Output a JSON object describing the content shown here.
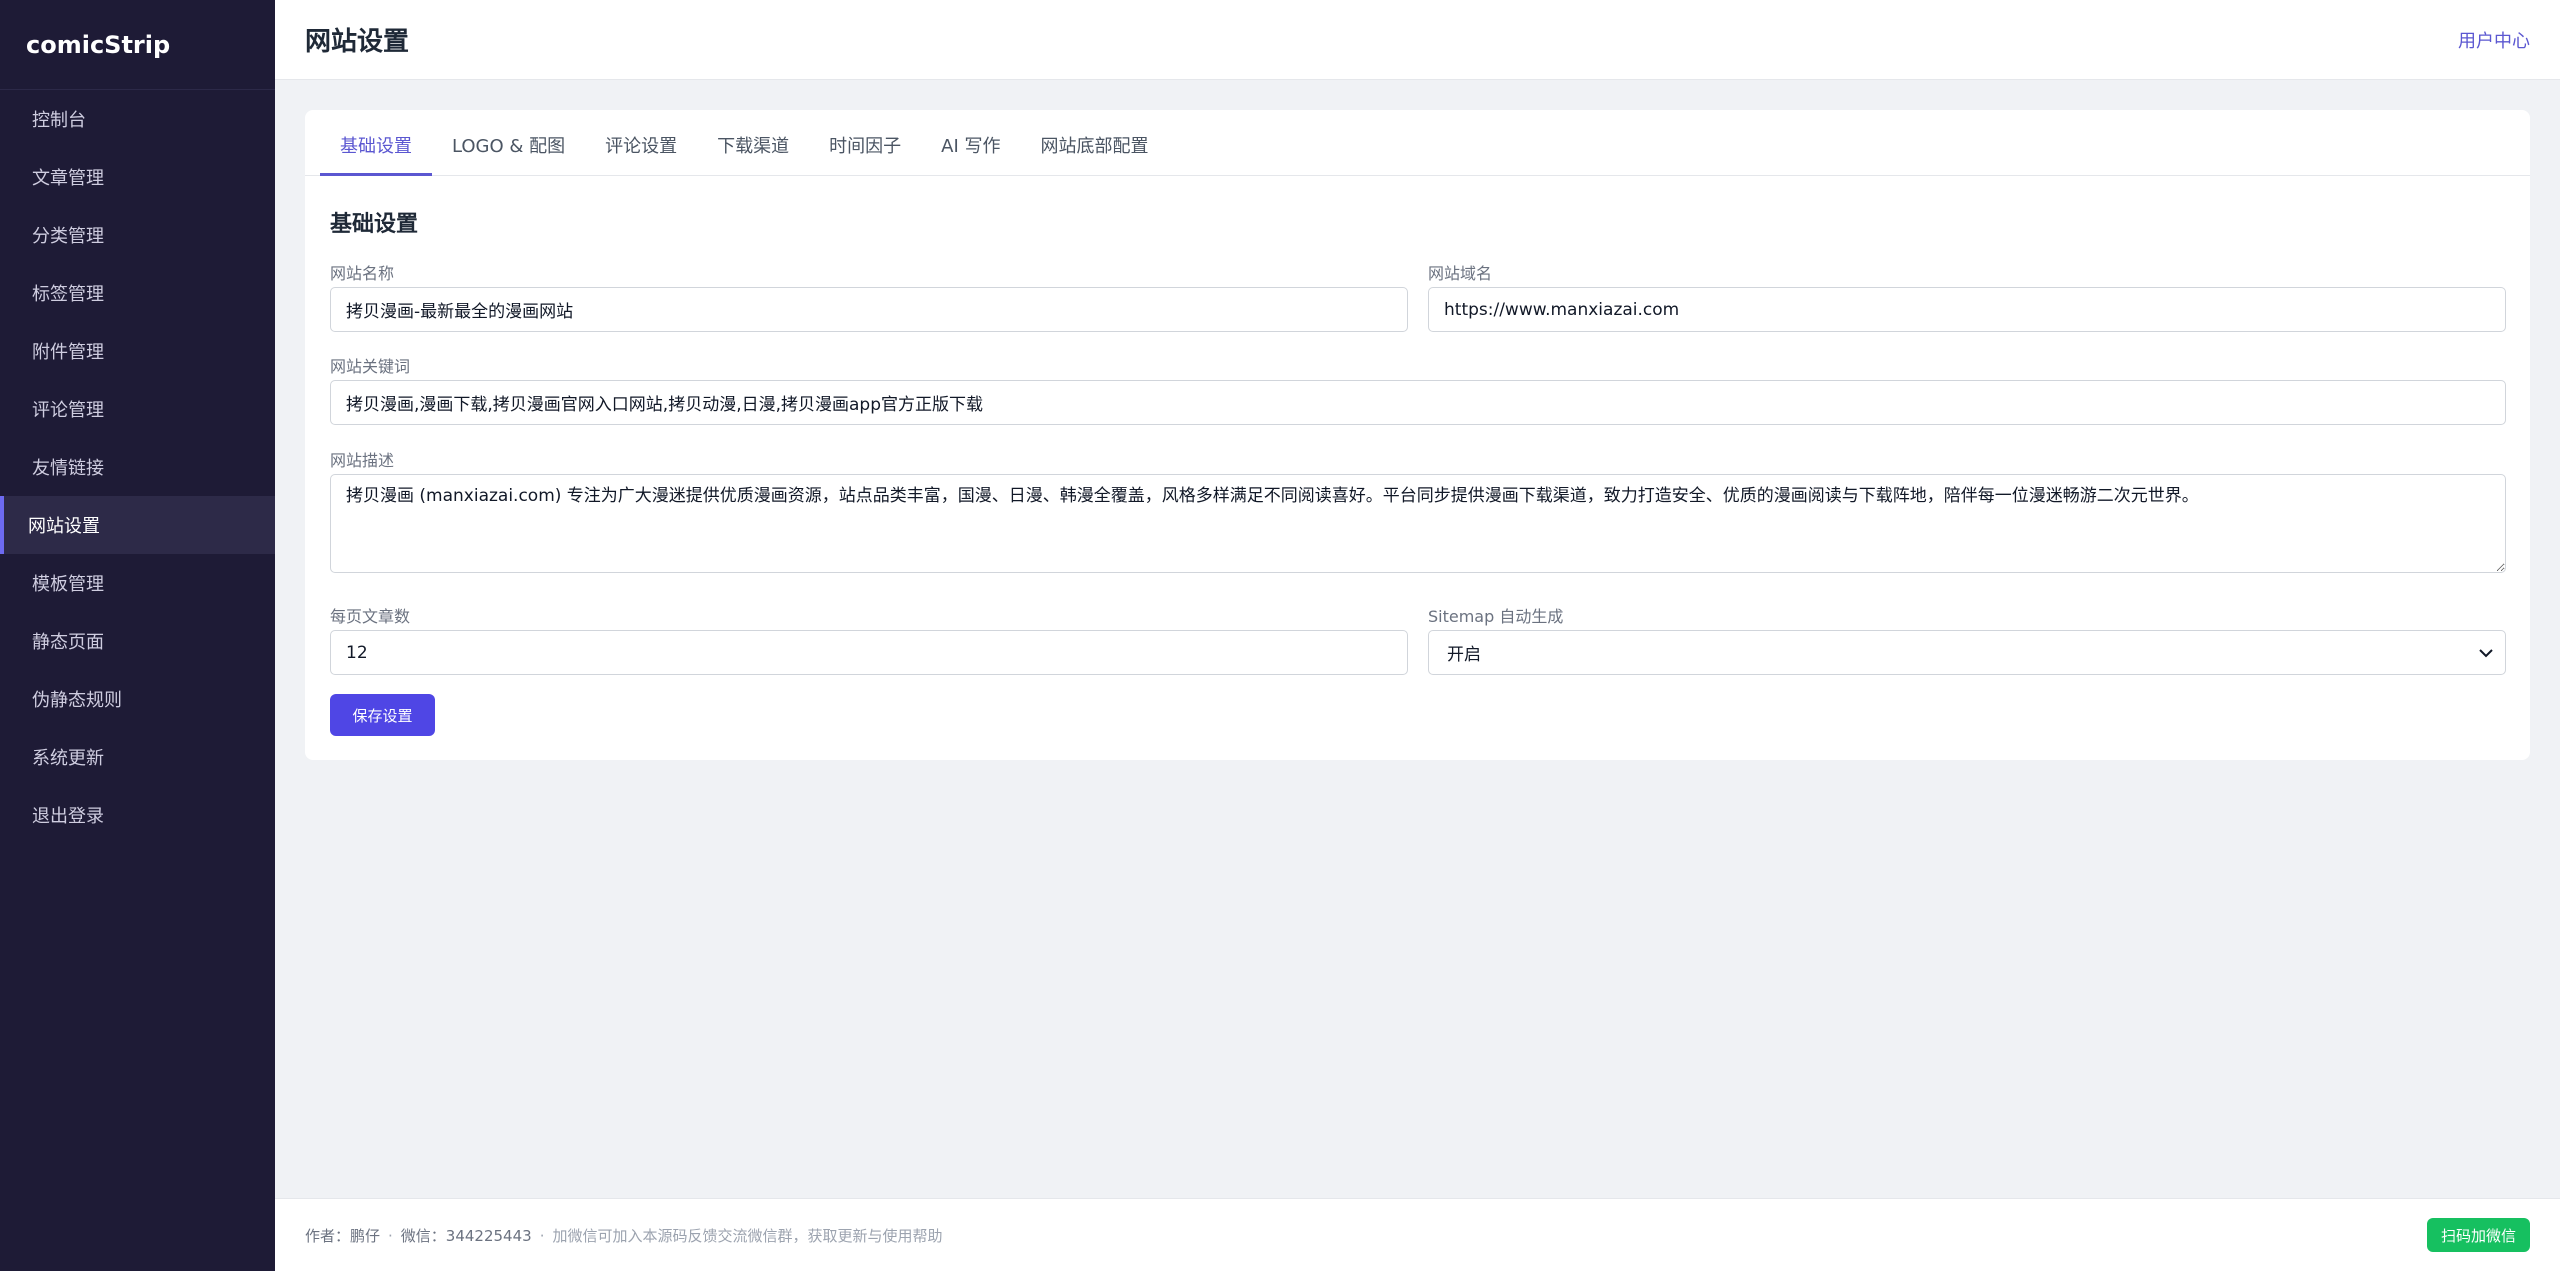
{
  "brand": "comicStrip",
  "sidebar": {
    "items": [
      {
        "label": "控制台"
      },
      {
        "label": "文章管理"
      },
      {
        "label": "分类管理"
      },
      {
        "label": "标签管理"
      },
      {
        "label": "附件管理"
      },
      {
        "label": "评论管理"
      },
      {
        "label": "友情链接"
      },
      {
        "label": "网站设置"
      },
      {
        "label": "模板管理"
      },
      {
        "label": "静态页面"
      },
      {
        "label": "伪静态规则"
      },
      {
        "label": "系统更新"
      },
      {
        "label": "退出登录"
      }
    ],
    "active_index": 7
  },
  "header": {
    "title": "网站设置",
    "user_center": "用户中心"
  },
  "tabs": [
    {
      "label": "基础设置"
    },
    {
      "label": "LOGO & 配图"
    },
    {
      "label": "评论设置"
    },
    {
      "label": "下载渠道"
    },
    {
      "label": "时间因子"
    },
    {
      "label": "AI 写作"
    },
    {
      "label": "网站底部配置"
    }
  ],
  "form": {
    "section_title": "基础设置",
    "site_name": {
      "label": "网站名称",
      "value": "拷贝漫画-最新最全的漫画网站"
    },
    "site_domain": {
      "label": "网站域名",
      "value": "https://www.manxiazai.com"
    },
    "keywords": {
      "label": "网站关键词",
      "value": "拷贝漫画,漫画下载,拷贝漫画官网入口网站,拷贝动漫,日漫,拷贝漫画app官方正版下载"
    },
    "description": {
      "label": "网站描述",
      "value": "拷贝漫画 (manxiazai.com) 专注为广大漫迷提供优质漫画资源，站点品类丰富，国漫、日漫、韩漫全覆盖，风格多样满足不同阅读喜好。平台同步提供漫画下载渠道，致力打造安全、优质的漫画阅读与下载阵地，陪伴每一位漫迷畅游二次元世界。"
    },
    "per_page": {
      "label": "每页文章数",
      "value": "12"
    },
    "sitemap": {
      "label": "Sitemap 自动生成",
      "value": "开启"
    },
    "save_label": "保存设置"
  },
  "footer": {
    "author": "作者：鹏仔",
    "wechat": "微信：344225443",
    "note": "加微信可加入本源码反馈交流微信群，获取更新与使用帮助",
    "wechat_button": "扫码加微信"
  },
  "colors": {
    "sidebar_bg": "#1e1b36",
    "accent": "#5b57d1",
    "primary_button": "#4f46e5",
    "wechat_green": "#16c060"
  }
}
